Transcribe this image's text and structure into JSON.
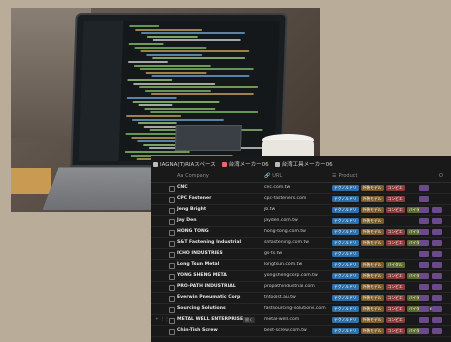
{
  "tabs": [
    {
      "label": "IAGNA(T)RIAスペース",
      "icon": "page-icon"
    },
    {
      "label": "台湾メーカー06",
      "icon": "red-page-icon"
    },
    {
      "label": "台湾工具メーカー06",
      "icon": "page-icon"
    }
  ],
  "columns": {
    "company": "Aa Company",
    "url": "URL",
    "product": "Product",
    "more": "O"
  },
  "rows": [
    {
      "name": "CNC",
      "url": "cnc.com.tw",
      "tags": [
        [
          "テクノルドリ",
          "#2f6fa8"
        ],
        [
          "外装モデル",
          "#7a5a2a"
        ],
        [
          "コンピエ",
          "#8b3a3a"
        ]
      ],
      "extra": 1
    },
    {
      "name": "CPC Fastener",
      "url": "cpc-fasteners.com",
      "tags": [
        [
          "テクノルドリ",
          "#2f6fa8"
        ],
        [
          "外装モデル",
          "#7a5a2a"
        ],
        [
          "コンピエ",
          "#8b3a3a"
        ]
      ],
      "extra": 1
    },
    {
      "name": "Jeng Bright",
      "url": "jb.tw",
      "tags": [
        [
          "テクノルドリ",
          "#2f6fa8"
        ],
        [
          "外装モデル",
          "#7a5a2a"
        ],
        [
          "コンピエ",
          "#8b3a3a"
        ],
        [
          "バイタル",
          "#5b6b2e"
        ]
      ],
      "extra": 2
    },
    {
      "name": "Jay Den",
      "url": "jayden.com.tw",
      "tags": [
        [
          "テクノルドリ",
          "#2f6fa8"
        ],
        [
          "外装モデル",
          "#7a5a2a"
        ]
      ],
      "extra": 2
    },
    {
      "name": "HONG TONG",
      "url": "hong-tong.com.tw",
      "tags": [
        [
          "テクノルドリ",
          "#2f6fa8"
        ],
        [
          "外装モデル",
          "#7a5a2a"
        ],
        [
          "コンピエ",
          "#8b3a3a"
        ],
        [
          "バイタル",
          "#5b6b2e"
        ]
      ],
      "extra": 2
    },
    {
      "name": "S&T Fastening Industrial",
      "url": "snfastening.com.tw",
      "tags": [
        [
          "テクノルドリ",
          "#2f6fa8"
        ],
        [
          "外装モデル",
          "#7a5a2a"
        ],
        [
          "コンピエ",
          "#8b3a3a"
        ],
        [
          "バイタル",
          "#5b6b2e"
        ]
      ],
      "extra": 2
    },
    {
      "name": "ICHO INDUSTRIES",
      "url": "gs-ts.tw",
      "tags": [
        [
          "テクノルドリ",
          "#2f6fa8"
        ]
      ],
      "extra": 2
    },
    {
      "name": "Long Tsun Metal",
      "url": "longtsun.com.tw",
      "tags": [
        [
          "テクノルドリ",
          "#2f6fa8"
        ],
        [
          "外装モデル",
          "#7a5a2a"
        ],
        [
          "バイタル",
          "#5b6b2e"
        ]
      ],
      "extra": 2
    },
    {
      "name": "YONG SHENG META",
      "url": "yongshengcorp.com.tw",
      "tags": [
        [
          "テクノルドリ",
          "#2f6fa8"
        ],
        [
          "外装モデル",
          "#7a5a2a"
        ],
        [
          "コンピエ",
          "#8b3a3a"
        ],
        [
          "バイタル",
          "#5b6b2e"
        ]
      ],
      "extra": 2
    },
    {
      "name": "PRO-PATH INDUSTRIAL",
      "url": "propathindustrial.com",
      "tags": [
        [
          "テクノルドリ",
          "#2f6fa8"
        ],
        [
          "外装モデル",
          "#7a5a2a"
        ],
        [
          "コンピエ",
          "#8b3a3a"
        ]
      ],
      "extra": 2
    },
    {
      "name": "Everwin Pneumatic Corp",
      "url": "tntoolst.au.tw",
      "tags": [
        [
          "テクノルドリ",
          "#2f6fa8"
        ],
        [
          "外装モデル",
          "#7a5a2a"
        ],
        [
          "コンピエ",
          "#8b3a3a"
        ],
        [
          "バイタル",
          "#5b6b2e"
        ]
      ],
      "extra": 2
    },
    {
      "name": "Sourcing Solutions",
      "url": "fastsourcing-solutions.com",
      "tags": [
        [
          "テクノルドリ",
          "#2f6fa8"
        ],
        [
          "外装モデル",
          "#7a5a2a"
        ],
        [
          "コンピエ",
          "#8b3a3a"
        ],
        [
          "バイタル",
          "#5b6b2e"
        ],
        [
          "ETA",
          "#3b3b3b"
        ]
      ],
      "extra": 2
    },
    {
      "name": "METAL WELL ENTERPRISE",
      "url": "metal-well.com",
      "badge": "開く",
      "tags": [
        [
          "テクノルドリ",
          "#2f6fa8"
        ],
        [
          "外装モデル",
          "#7a5a2a"
        ],
        [
          "コンピエ",
          "#8b3a3a"
        ]
      ],
      "extra": 2,
      "handle": "+ ⋮⋮"
    },
    {
      "name": "Chin-Tish Screw",
      "url": "best-screw.com.tw",
      "tags": [
        [
          "テクノルドリ",
          "#2f6fa8"
        ],
        [
          "外装モデル",
          "#7a5a2a"
        ],
        [
          "コンピエ",
          "#8b3a3a"
        ],
        [
          "バイタル",
          "#5b6b2e"
        ]
      ],
      "extra": 2
    }
  ],
  "colors": {
    "bg": "#191919",
    "tagBlue": "#2f6fa8",
    "tagBrown": "#7a5a2a",
    "tagRed": "#8b3a3a",
    "tagGreen": "#5b6b2e",
    "miniPurple": "#6a4a8a"
  }
}
